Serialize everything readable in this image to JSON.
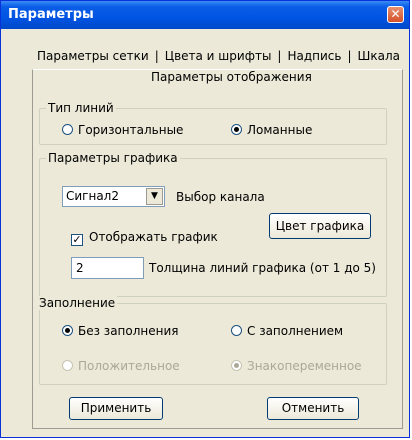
{
  "window": {
    "title": "Параметры",
    "close_glyph": "✕"
  },
  "tabs": [
    {
      "label": "Параметры сетки"
    },
    {
      "label": "Цвета и шрифты"
    },
    {
      "label": "Надпись"
    },
    {
      "label": "Шкала"
    }
  ],
  "tab_separator": "|",
  "panel_caption": "Параметры отображения",
  "line_type": {
    "label": "Тип линий",
    "options": [
      {
        "label": "Горизонтальные",
        "selected": false
      },
      {
        "label": "Ломанные",
        "selected": true
      }
    ]
  },
  "graph": {
    "label": "Параметры графика",
    "channel_value": "Сигнал2",
    "channel_label": "Выбор канала",
    "show_graph_label": "Отображать график",
    "show_graph_checked": true,
    "color_button": "Цвет графика",
    "thickness_value": "2",
    "thickness_label": "Толщина линий графика (от 1 до 5)"
  },
  "fill": {
    "label": "Заполнение",
    "no_fill": "Без заполнения",
    "with_fill": "С заполнением",
    "positive": "Положительное",
    "alternating": "Знакопеременное"
  },
  "buttons": {
    "apply": "Применить",
    "cancel": "Отменить"
  }
}
